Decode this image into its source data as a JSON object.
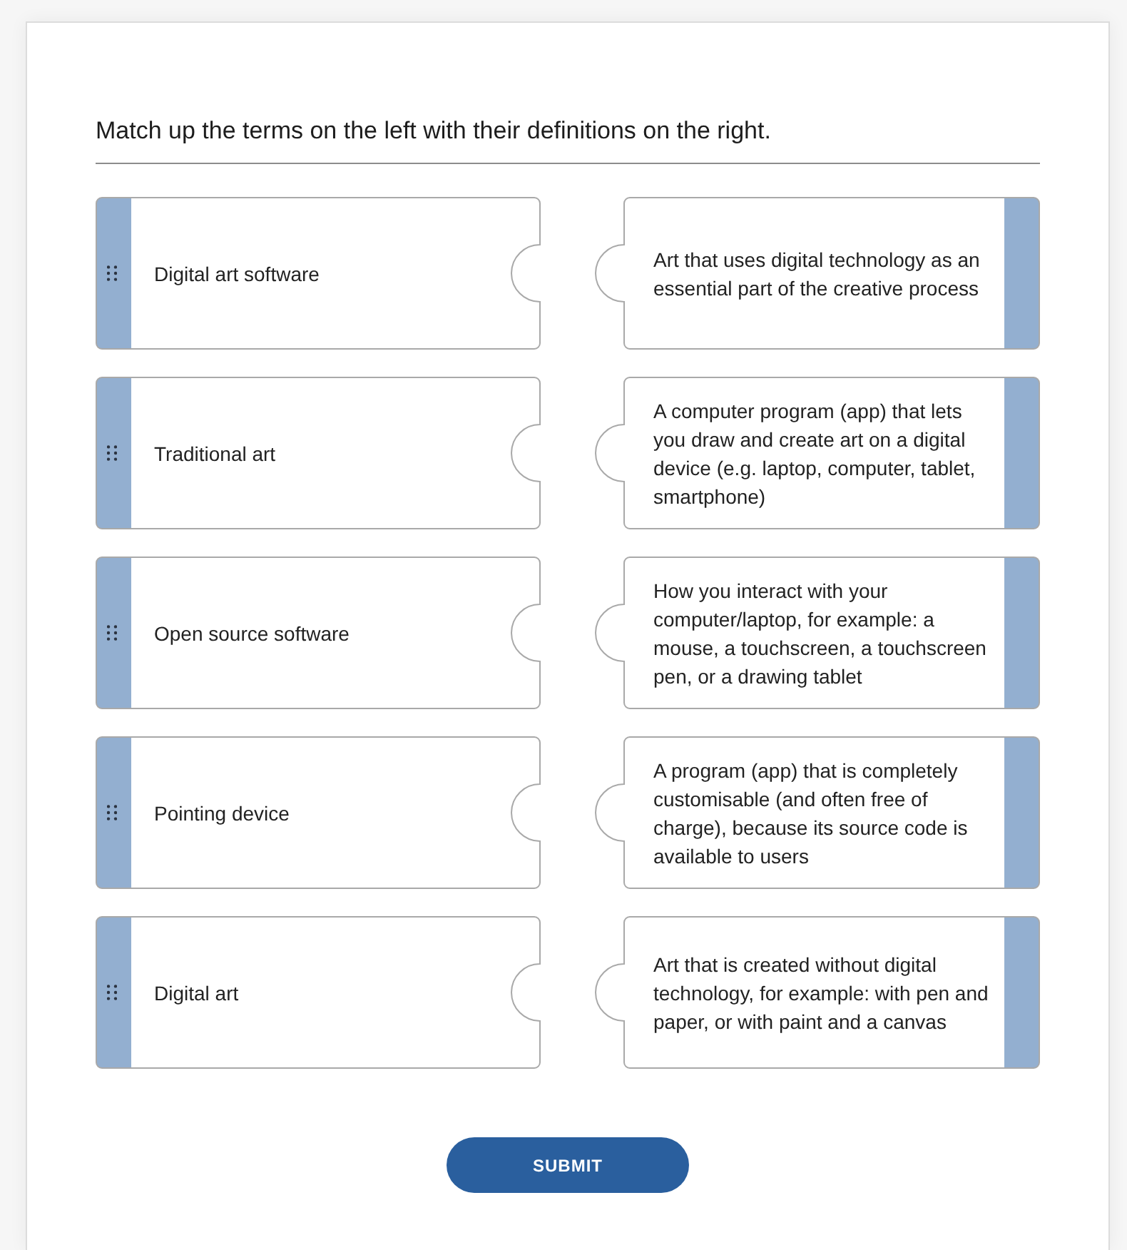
{
  "instruction": "Match up the terms on the left with their definitions on the right.",
  "terms": [
    {
      "label": "Digital art software"
    },
    {
      "label": "Traditional art"
    },
    {
      "label": "Open source software"
    },
    {
      "label": "Pointing device"
    },
    {
      "label": "Digital art"
    }
  ],
  "definitions": [
    {
      "text": "Art that uses digital technology as an essential part of the creative process"
    },
    {
      "text": "A computer program (app) that lets you draw and create art on a digital device (e.g. laptop, computer, tablet, smartphone)"
    },
    {
      "text": "How you interact with your computer/laptop, for example: a mouse, a touchscreen, a touchscreen pen, or a drawing tablet"
    },
    {
      "text": "A program (app) that is completely customisable (and often free of charge), because its source code is available to users"
    },
    {
      "text": "Art that is created without digital technology, for example: with pen and paper, or with paint and a canvas"
    }
  ],
  "submit_button": {
    "label": "SUBMIT"
  }
}
